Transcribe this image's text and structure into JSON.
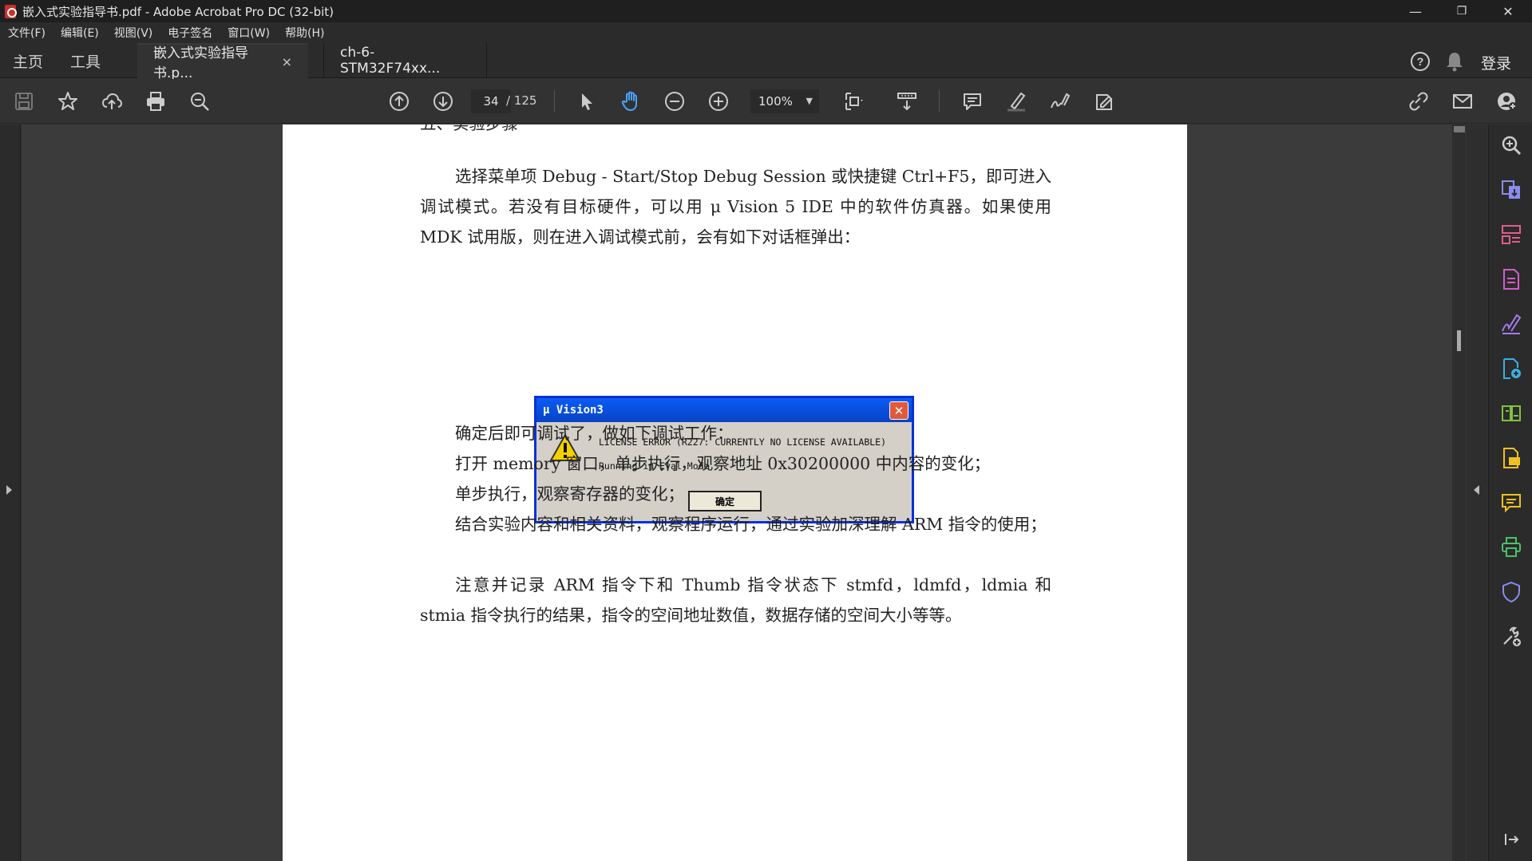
{
  "window": {
    "title": "嵌入式实验指导书.pdf - Adobe Acrobat Pro DC (32-bit)",
    "minimize": "—",
    "restore": "❐",
    "close": "✕"
  },
  "menu": [
    "文件(F)",
    "编辑(E)",
    "视图(V)",
    "电子签名",
    "窗口(W)",
    "帮助(H)"
  ],
  "tabs": {
    "home": "主页",
    "tools": "工具",
    "documents": [
      {
        "label": "嵌入式实验指导书.p...",
        "active": true,
        "close": "×"
      },
      {
        "label": "ch-6-STM32F74xx...",
        "active": false
      }
    ],
    "login": "登录"
  },
  "toolbar": {
    "page_current": "34",
    "page_total": "/ 125",
    "zoom": "100%"
  },
  "document": {
    "heading_partial": "五、实验步骤",
    "paragraphs": [
      "选择菜单项 Debug - Start/Stop Debug Session 或快捷键 Ctrl+F5，即可进入调试模式。若没有目标硬件，可以用 μ Vision 5 IDE 中的软件仿真器。如果使用 MDK 试用版，则在进入调试模式前，会有如下对话框弹出：",
      "确定后即可调试了，做如下调试工作：",
      "打开 memory 窗口，单步执行，观察地址 0x30200000 中内容的变化；",
      "单步执行，观察寄存器的变化；",
      "结合实验内容和相关资料，观察程序运行，通过实验加深理解 ARM 指令的使用；",
      "注意并记录 ARM 指令下和 Thumb 指令状态下 stmfd，ldmfd，ldmia 和 stmia 指令执行的结果，指令的空间地址数值，数据存储的空间大小等等。"
    ],
    "dialog": {
      "title": "μ Vision3",
      "line1": "LICENSE ERROR (R227: CURRENTLY NO LICENSE AVAILABLE)",
      "line2": "Running in Eval Mode",
      "ok": "确定"
    }
  },
  "colors": {
    "accent_blue": "#4aa3ff",
    "dialog_title_blue": "#0843c4"
  }
}
